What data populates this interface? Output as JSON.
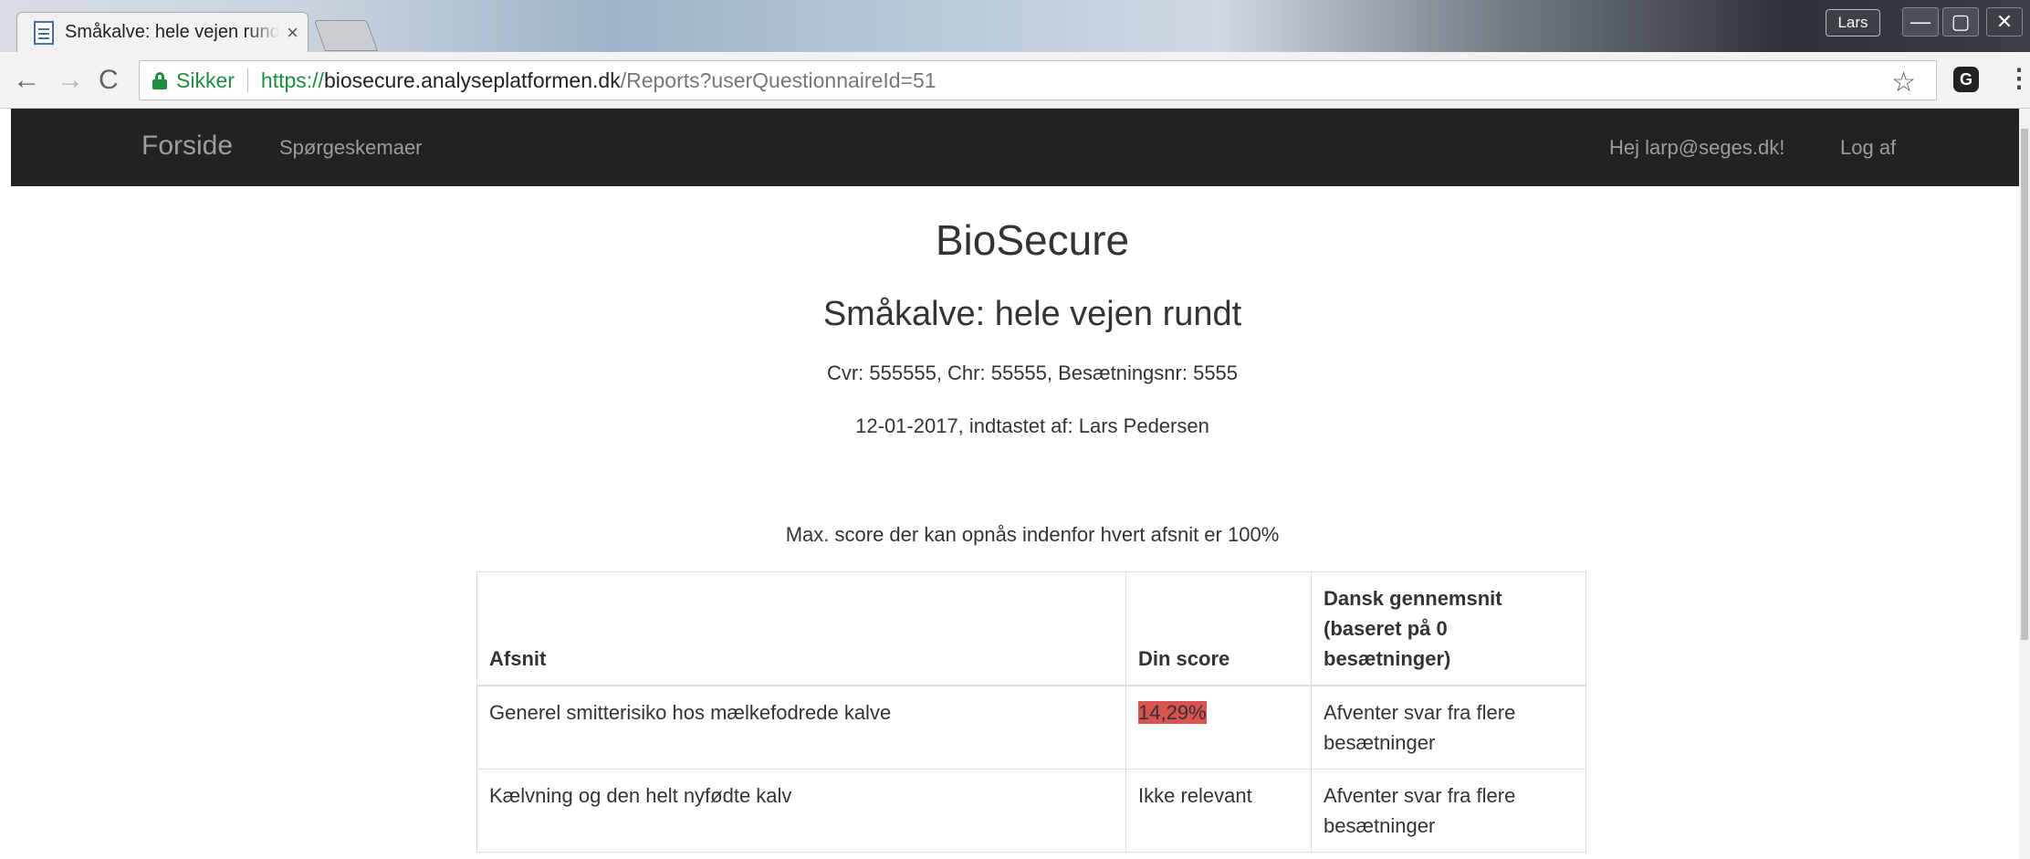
{
  "browser": {
    "tab_title": "Småkalve: hele vejen rundt",
    "tab_close": "×",
    "user_badge": "Lars",
    "window_buttons": {
      "minimize": "—",
      "maximize": "▢",
      "close": "✕"
    },
    "nav": {
      "back": "←",
      "forward": "→",
      "reload": "C"
    },
    "secure_label": "Sikker",
    "url": {
      "scheme": "https://",
      "host": "biosecure.analyseplatformen.dk",
      "path": "/Reports?userQuestionnaireId=51"
    },
    "bookmark_icon": "☆",
    "extension_icon": "G",
    "menu_icon": "⋮"
  },
  "site_nav": {
    "brand": "Forside",
    "questionnaires": "Spørgeskemaer",
    "greeting": "Hej larp@seges.dk!",
    "logoff": "Log af"
  },
  "report": {
    "title": "BioSecure",
    "subtitle": "Småkalve: hele vejen rundt",
    "ids": "Cvr: 555555, Chr: 55555, Besætningsnr: 5555",
    "entered": "12-01-2017, indtastet af: Lars Pedersen",
    "max_note": "Max. score der kan opnås indenfor hvert afsnit er 100%"
  },
  "table": {
    "headers": [
      "Afsnit",
      "Din score",
      "Dansk gennemsnit (baseret på 0 besætninger)"
    ],
    "rows": [
      {
        "section": "Generel smitterisiko hos mælkefodrede kalve",
        "score": "14,29%",
        "average": "Afventer svar fra flere besætninger"
      },
      {
        "section": "Kælvning og den helt nyfødte kalv",
        "score": "Ikke relevant",
        "average": "Afventer svar fra flere besætninger"
      }
    ]
  },
  "colors": {
    "navbar": "#222222",
    "score_low": "#d9534f",
    "secure_green": "#1e8e3e"
  }
}
